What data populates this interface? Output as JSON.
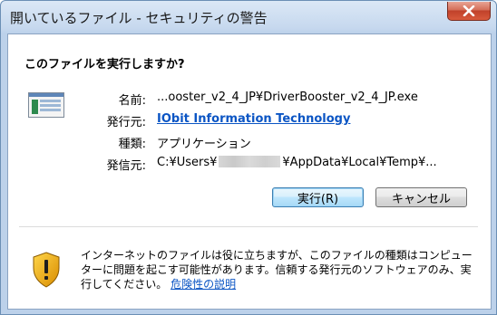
{
  "window": {
    "title": "開いているファイル - セキュリティの警告",
    "close_icon": "close-icon"
  },
  "dialog": {
    "question": "このファイルを実行しますか?",
    "file_icon": "application-file-icon",
    "fields": {
      "name_label": "名前:",
      "name_value": "...ooster_v2_4_JP¥DriverBooster_v2_4_JP.exe",
      "publisher_label": "発行元:",
      "publisher_value": "IObit Information Technology",
      "type_label": "種類:",
      "type_value": "アプリケーション",
      "from_label": "発信元:",
      "from_prefix": "C:¥Users¥",
      "from_suffix": "¥AppData¥Local¥Temp¥..."
    },
    "buttons": {
      "run_label": "実行(R)",
      "cancel_label": "キャンセル"
    }
  },
  "warning": {
    "shield_icon": "security-shield-icon",
    "text": "インターネットのファイルは役に立ちますが、このファイルの種類はコンピューターに問題を起こす可能性があります。信頼する発行元のソフトウェアのみ、実行してください。",
    "link": "危険性の説明"
  },
  "colors": {
    "link": "#0b55c4",
    "close_button": "#c0412a",
    "default_button_border": "#3c7fb1"
  }
}
